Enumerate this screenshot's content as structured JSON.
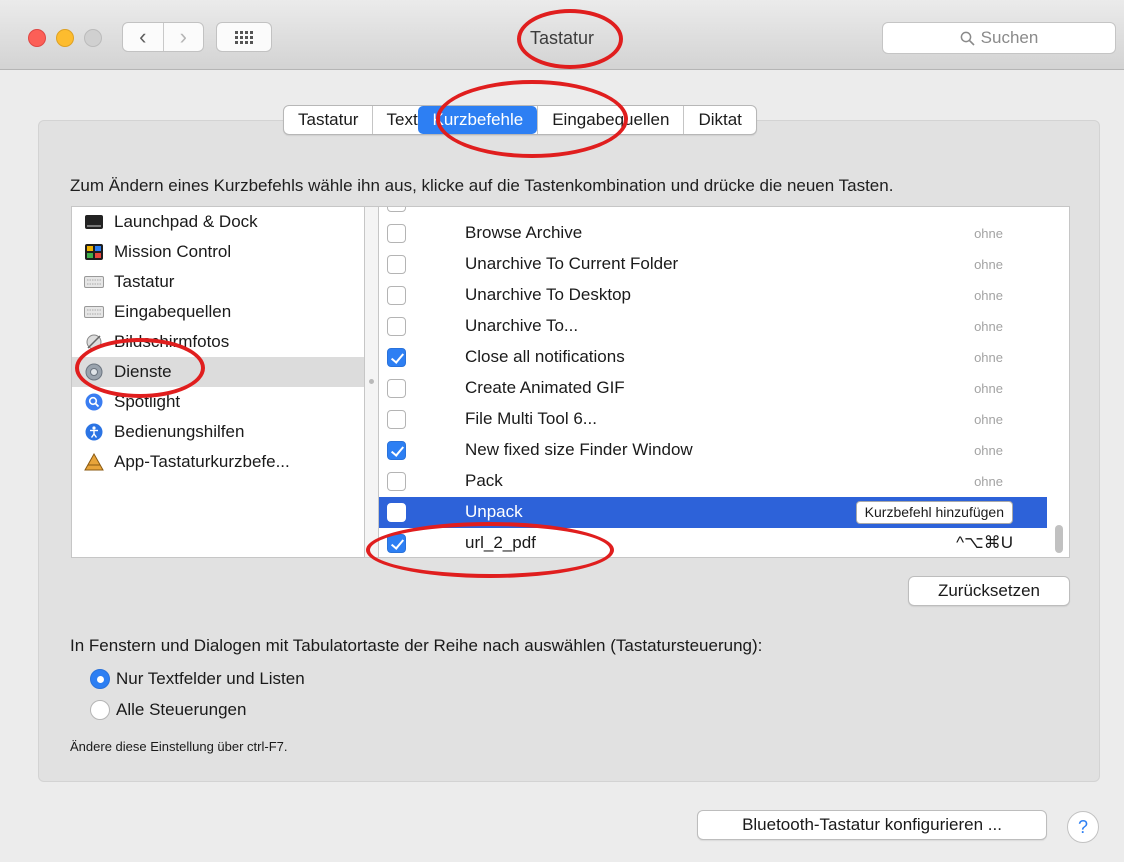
{
  "window": {
    "title": "Tastatur",
    "search_placeholder": "Suchen"
  },
  "tabs": [
    {
      "label": "Tastatur",
      "active": false
    },
    {
      "label": "Text",
      "active": false
    },
    {
      "label": "Kurzbefehle",
      "active": true
    },
    {
      "label": "Eingabequellen",
      "active": false
    },
    {
      "label": "Diktat",
      "active": false
    }
  ],
  "instruction": "Zum Ändern eines Kurzbefehls wähle ihn aus, klicke auf die Tastenkombination und drücke die neuen Tasten.",
  "categories": [
    {
      "label": "Launchpad & Dock",
      "icon": "launchpad-icon"
    },
    {
      "label": "Mission Control",
      "icon": "mission-control-icon"
    },
    {
      "label": "Tastatur",
      "icon": "keyboard-icon"
    },
    {
      "label": "Eingabequellen",
      "icon": "keyboard-icon"
    },
    {
      "label": "Bildschirmfotos",
      "icon": "screenshot-icon"
    },
    {
      "label": "Dienste",
      "icon": "gear-icon",
      "selected": true
    },
    {
      "label": "Spotlight",
      "icon": "spotlight-icon"
    },
    {
      "label": "Bedienungshilfen",
      "icon": "accessibility-icon"
    },
    {
      "label": "App-Tastaturkurzbefe...",
      "icon": "app-shortcuts-icon"
    }
  ],
  "shortcuts": [
    {
      "label": "Browse Archive",
      "checked": false,
      "key": "ohne"
    },
    {
      "label": "Unarchive To Current Folder",
      "checked": false,
      "key": "ohne"
    },
    {
      "label": "Unarchive To Desktop",
      "checked": false,
      "key": "ohne"
    },
    {
      "label": "Unarchive To...",
      "checked": false,
      "key": "ohne"
    },
    {
      "label": "Close all notifications",
      "checked": true,
      "key": "ohne"
    },
    {
      "label": "Create Animated GIF",
      "checked": false,
      "key": "ohne"
    },
    {
      "label": "File Multi Tool 6...",
      "checked": false,
      "key": "ohne"
    },
    {
      "label": "New fixed size Finder Window",
      "checked": true,
      "key": "ohne"
    },
    {
      "label": "Pack",
      "checked": false,
      "key": "ohne"
    },
    {
      "label": "Unpack",
      "checked": false,
      "key": "",
      "selected": true,
      "button": "Kurzbefehl hinzufügen"
    },
    {
      "label": "url_2_pdf",
      "checked": true,
      "key": "^⌥⌘U"
    }
  ],
  "buttons": {
    "reset": "Zurücksetzen",
    "bluetooth": "Bluetooth-Tastatur konfigurieren ...",
    "help": "?"
  },
  "keyboard_nav": {
    "label": "In Fenstern und Dialogen mit Tabulatortaste der Reihe nach auswählen (Tastatursteuerung):",
    "options": [
      {
        "label": "Nur Textfelder und Listen",
        "selected": true
      },
      {
        "label": "Alle Steuerungen",
        "selected": false
      }
    ],
    "hint": "Ändere diese Einstellung über ctrl-F7."
  },
  "colors": {
    "accent": "#2d7ff3",
    "selection": "#2d62d9",
    "annotation": "#e01e1e"
  }
}
